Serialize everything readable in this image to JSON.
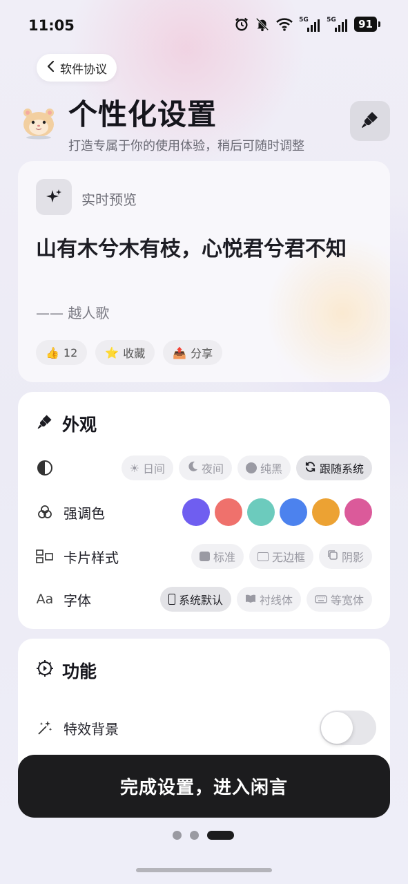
{
  "status_bar": {
    "time": "11:05",
    "network_1": "5G",
    "network_2": "5G",
    "battery": "91",
    "icons": [
      "alarm-icon",
      "bell-off-icon",
      "wifi-icon",
      "signal-icon",
      "signal-icon",
      "battery-icon"
    ]
  },
  "nav": {
    "back_label": "软件协议"
  },
  "header": {
    "title": "个性化设置",
    "subtitle": "打造专属于你的使用体验，稍后可随时调整"
  },
  "preview": {
    "label": "实时预览",
    "quote": "山有木兮木有枝，心悦君兮君不知",
    "author": "—— 越人歌",
    "like_count": "12",
    "favorite_label": "收藏",
    "share_label": "分享"
  },
  "appearance": {
    "title": "外观",
    "theme_options": [
      {
        "icon": "sun-icon",
        "label": "日间",
        "active": false
      },
      {
        "icon": "moon-icon",
        "label": "夜间",
        "active": false
      },
      {
        "icon": "circle-icon",
        "label": "纯黑",
        "active": false
      },
      {
        "icon": "sync-icon",
        "label": "跟随系统",
        "active": true
      }
    ],
    "accent_label": "强调色",
    "accent_colors": [
      "#6f5ef0",
      "#ef716c",
      "#6ccbbd",
      "#4c82ee",
      "#eca233",
      "#db5a9a"
    ],
    "card_style_label": "卡片样式",
    "card_style_options": [
      {
        "icon": "card-icon",
        "label": "标准",
        "active": false
      },
      {
        "icon": "square-icon",
        "label": "无边框",
        "active": false
      },
      {
        "icon": "copy-icon",
        "label": "阴影",
        "active": false
      }
    ],
    "font_label": "字体",
    "font_icon_text": "Aa",
    "font_options": [
      {
        "icon": "phone-icon",
        "label": "系统默认",
        "active": true
      },
      {
        "icon": "book-icon",
        "label": "衬线体",
        "active": false
      },
      {
        "icon": "keyboard-icon",
        "label": "等宽体",
        "active": false
      }
    ]
  },
  "features": {
    "title": "功能",
    "effects_label": "特效背景",
    "effects_enabled": false
  },
  "finish_label": "完成设置，进入闲言",
  "pager": {
    "total": 3,
    "current": 3
  },
  "colors": {
    "dark_button": "#1c1c1e",
    "card_bg": "#ffffff",
    "page_bg": "#ecebf5"
  }
}
